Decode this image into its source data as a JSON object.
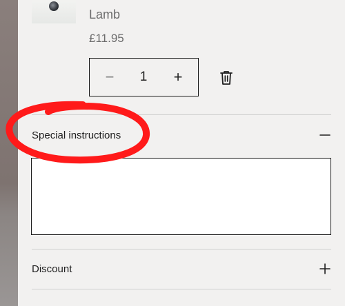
{
  "cart_item": {
    "name": "Lamb",
    "price": "£11.95",
    "quantity": "1",
    "decrease_symbol": "−",
    "increase_symbol": "+"
  },
  "special_instructions": {
    "label": "Special instructions",
    "toggle_icon": "minus-icon",
    "value": "",
    "state": "expanded"
  },
  "discount": {
    "label": "Discount",
    "toggle_icon": "plus-icon",
    "state": "collapsed"
  },
  "annotation": {
    "color": "#ff1a1a",
    "shape": "freehand-circle"
  },
  "colors": {
    "panel_background": "#f2f1f0",
    "border": "#1a1a1a",
    "muted_text": "#6c6c6c"
  }
}
